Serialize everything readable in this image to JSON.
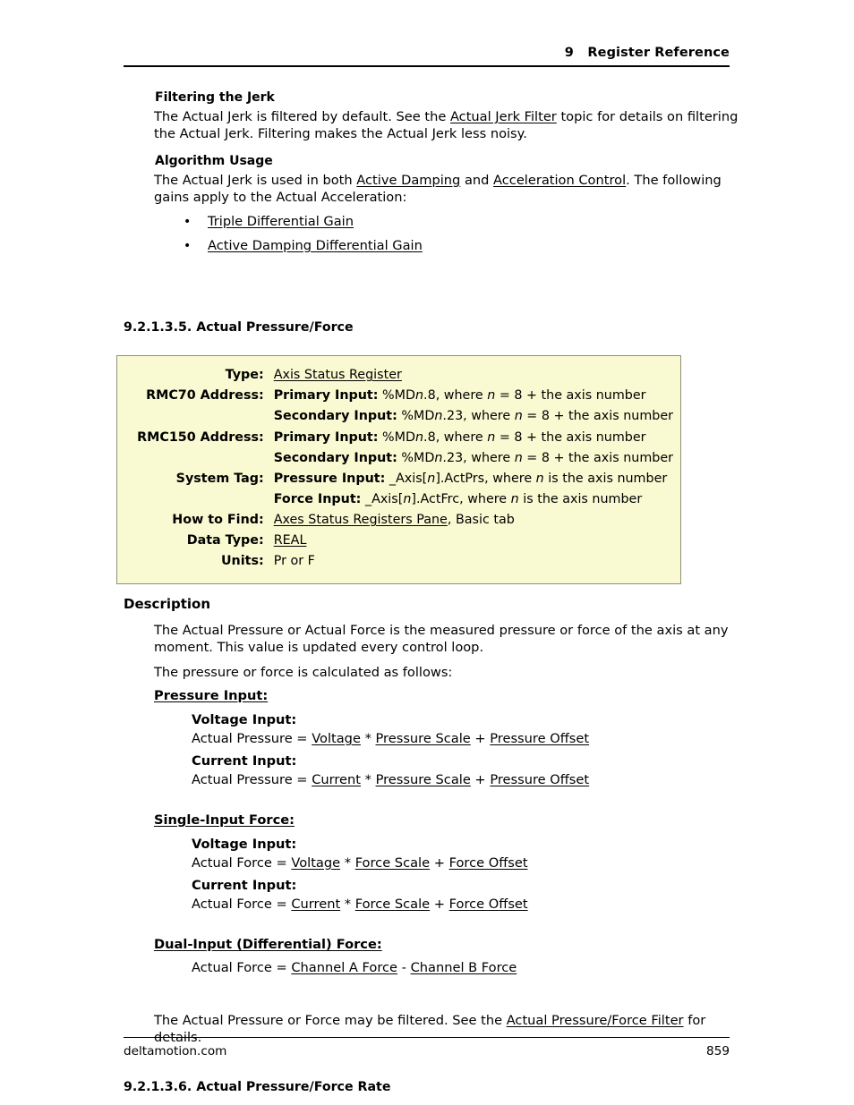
{
  "header": {
    "chapter_number": "9",
    "chapter_title": "Register Reference",
    "combined": "9   Register Reference"
  },
  "sections": {
    "filtering_the_jerk": {
      "heading": "Filtering the Jerk",
      "body_parts": {
        "before_link": "The Actual Jerk is filtered by default. See the ",
        "link": "Actual Jerk Filter",
        "after_link": " topic for details on filtering the Actual Jerk. Filtering makes the Actual Jerk less noisy."
      }
    },
    "algorithm_usage": {
      "heading": "Algorithm Usage",
      "body_parts": {
        "p1": "The Actual Jerk is used in both ",
        "link1": "Active Damping",
        "p2": " and ",
        "link2": "Acceleration Control",
        "p3": ". The following gains apply to the Actual Acceleration:"
      },
      "bullets": [
        {
          "bullet": "•",
          "label": "Triple Differential Gain"
        },
        {
          "bullet": "•",
          "label": "Active Damping Differential Gain"
        }
      ]
    }
  },
  "topic": {
    "number_title": "9.2.1.3.5. Actual Pressure/Force",
    "spec_table": {
      "background_color": "#fafad2",
      "border_color": "#8f8f7a",
      "rows": [
        {
          "label": "Type:",
          "lines": [
            {
              "link": "Axis Status Register"
            }
          ]
        },
        {
          "label": "RMC70 Address:",
          "lines": [
            {
              "bold": "Primary Input:",
              "rest_a": " %MD",
              "italic1": "n",
              "rest_b": ".8, where ",
              "italic2": "n",
              "rest_c": " = 8 + the axis number"
            },
            {
              "bold": "Secondary Input:",
              "rest_a": " %MD",
              "italic1": "n",
              "rest_b": ".23, where ",
              "italic2": "n",
              "rest_c": " = 8 + the axis number"
            }
          ]
        },
        {
          "label": "RMC150 Address:",
          "lines": [
            {
              "bold": "Primary Input:",
              "rest_a": " %MD",
              "italic1": "n",
              "rest_b": ".8, where ",
              "italic2": "n",
              "rest_c": " = 8 + the axis number"
            },
            {
              "bold": "Secondary Input:",
              "rest_a": " %MD",
              "italic1": "n",
              "rest_b": ".23, where ",
              "italic2": "n",
              "rest_c": " = 8 + the axis number"
            }
          ]
        },
        {
          "label": "System Tag:",
          "lines": [
            {
              "bold": "Pressure Input:",
              "rest_a": " _Axis[",
              "italic1": "n",
              "rest_b": "].ActPrs, where ",
              "italic2": "n",
              "rest_c": " is the axis number"
            },
            {
              "bold": "Force Input:",
              "rest_a": " _Axis[",
              "italic1": "n",
              "rest_b": "].ActFrc, where ",
              "italic2": "n",
              "rest_c": " is the axis number"
            }
          ]
        },
        {
          "label": "How to Find:",
          "lines": [
            {
              "link": "Axes Status Registers Pane",
              "plain": ", Basic tab"
            }
          ]
        },
        {
          "label": "Data Type:",
          "lines": [
            {
              "link": "REAL"
            }
          ]
        },
        {
          "label": "Units:",
          "lines": [
            {
              "plain": "Pr or F"
            }
          ]
        }
      ]
    },
    "description": {
      "heading": "Description",
      "paragraph_1": "The Actual Pressure or Actual Force is the measured pressure or force of the axis at any moment. This value is updated every control loop.",
      "paragraph_2": "The pressure or force is calculated as follows:",
      "groups": [
        {
          "title": "Pressure Input:",
          "items": [
            {
              "subtitle": "Voltage Input:",
              "formula": {
                "lead": "Actual Pressure = ",
                "t1": "Voltage",
                "op1": " * ",
                "t2": "Pressure Scale",
                "op2": " + ",
                "t3": "Pressure Offset"
              }
            },
            {
              "subtitle": "Current Input:",
              "formula": {
                "lead": "Actual Pressure = ",
                "t1": "Current",
                "op1": " * ",
                "t2": "Pressure Scale",
                "op2": " + ",
                "t3": "Pressure Offset"
              }
            }
          ]
        },
        {
          "title": "Single-Input Force:",
          "items": [
            {
              "subtitle": "Voltage Input:",
              "formula": {
                "lead": "Actual Force = ",
                "t1": "Voltage",
                "op1": " * ",
                "t2": "Force Scale",
                "op2": " + ",
                "t3": "Force Offset"
              }
            },
            {
              "subtitle": "Current Input:",
              "formula": {
                "lead": "Actual Force =  ",
                "t1": "Current",
                "op1": " * ",
                "t2": "Force Scale",
                "op2": " + ",
                "t3": "Force Offset"
              }
            }
          ]
        }
      ],
      "dual_input": {
        "title": "Dual-Input (Differential) Force:",
        "formula": {
          "lead": "Actual Force = ",
          "t1": "Channel A Force",
          "op1": " - ",
          "t2": "Channel B Force"
        }
      },
      "closing": {
        "before_link": "The Actual Pressure or Force may be filtered. See the ",
        "link": "Actual Pressure/Force Filter",
        "after_link": " for details."
      }
    }
  },
  "next_topic": {
    "number_title": "9.2.1.3.6. Actual Pressure/Force Rate"
  },
  "footer": {
    "site": "deltamotion.com",
    "page_number": "859"
  }
}
